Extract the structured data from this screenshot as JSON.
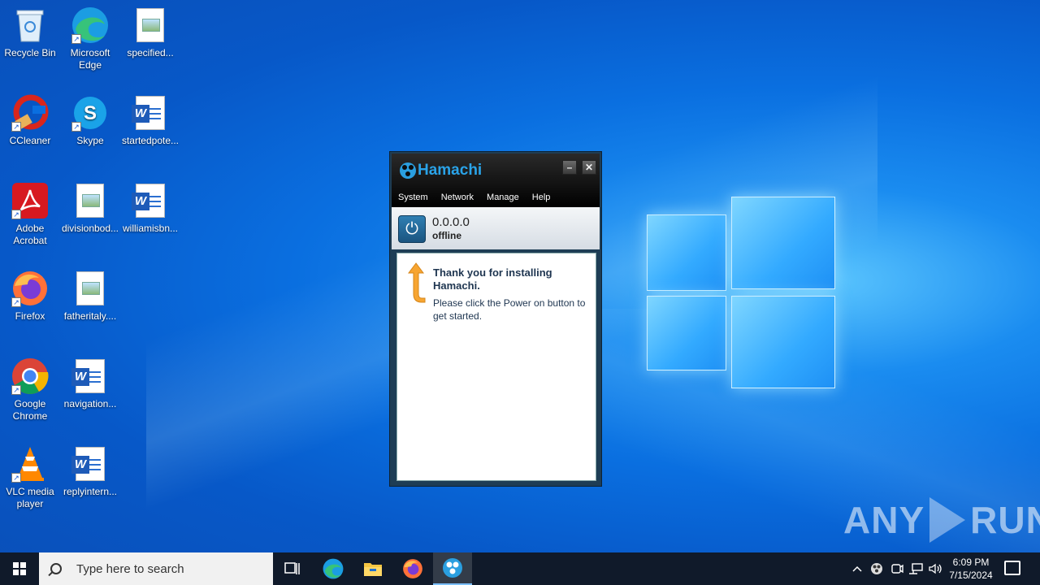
{
  "desktop": {
    "icons": [
      {
        "label": "Recycle Bin"
      },
      {
        "label": "Microsoft Edge"
      },
      {
        "label": "specified..."
      },
      {
        "label": "CCleaner"
      },
      {
        "label": "Skype"
      },
      {
        "label": "startedpote..."
      },
      {
        "label": "Adobe Acrobat"
      },
      {
        "label": "divisionbod..."
      },
      {
        "label": "williamisbn..."
      },
      {
        "label": "Firefox"
      },
      {
        "label": "fatheritaly...."
      },
      {
        "label": "Google Chrome"
      },
      {
        "label": "navigation..."
      },
      {
        "label": "VLC media player"
      },
      {
        "label": "replyintern..."
      }
    ]
  },
  "hamachi": {
    "title": "Hamachi",
    "minimize": "–",
    "close": "✕",
    "menu": [
      "System",
      "Network",
      "Manage",
      "Help"
    ],
    "status": {
      "ip": "0.0.0.0",
      "state": "offline"
    },
    "message": {
      "heading": "Thank you for installing Hamachi.",
      "body": "Please click the Power on button to get started."
    },
    "power_icon": "⏻"
  },
  "watermark": {
    "left": "ANY",
    "right": "RUN"
  },
  "taskbar": {
    "search_placeholder": "Type here to search",
    "apps": [
      "task-view-icon",
      "edge-icon",
      "file-explorer-icon",
      "firefox-icon",
      "hamachi-icon"
    ],
    "clock_time": "6:09 PM",
    "clock_date": "7/15/2024"
  },
  "colors": {
    "taskbar": "#101a2a",
    "hamachi_accent": "#2aa3e8",
    "desktop": "#0a6fe0"
  }
}
